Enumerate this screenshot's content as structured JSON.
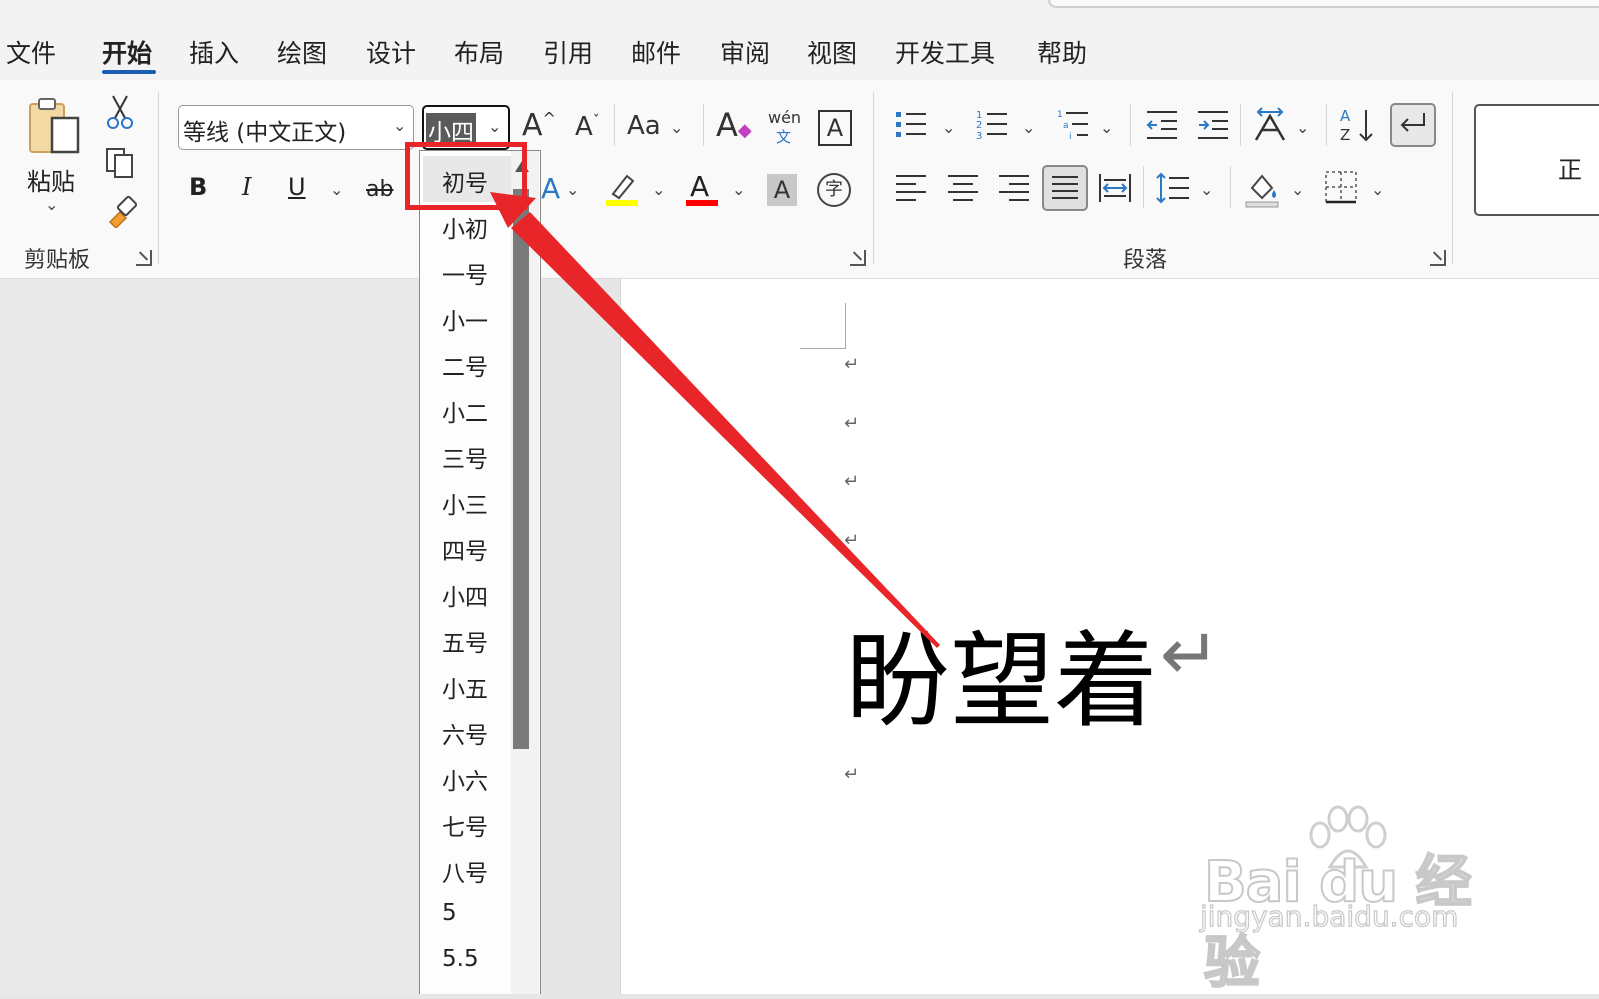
{
  "menu": {
    "tabs": [
      "文件",
      "开始",
      "插入",
      "绘图",
      "设计",
      "布局",
      "引用",
      "邮件",
      "审阅",
      "视图",
      "开发工具",
      "帮助"
    ],
    "active_tab": "开始"
  },
  "clipboard": {
    "paste_label": "粘贴",
    "group_label": "剪贴板"
  },
  "font": {
    "font_name": "等线 (中文正文)",
    "font_size": "小四",
    "grow_label": "A",
    "shrink_label": "A",
    "case_label": "Aa",
    "phonetic_top": "wén",
    "phonetic_bottom": "文",
    "border_char": "A",
    "bold": "B",
    "italic": "I",
    "underline": "U",
    "strike": "ab",
    "font_color_char": "A",
    "shade_char": "A",
    "enclose_char": "字",
    "highlight_color": "#ffff00",
    "font_color": "#ff0000"
  },
  "paragraph": {
    "group_label": "段落"
  },
  "styles": {
    "partial_label": "正"
  },
  "font_size_dropdown": {
    "items": [
      "初号",
      "小初",
      "一号",
      "小一",
      "二号",
      "小二",
      "三号",
      "小三",
      "四号",
      "小四",
      "五号",
      "小五",
      "六号",
      "小六",
      "七号",
      "八号",
      "5",
      "5.5"
    ],
    "highlighted": "初号"
  },
  "document": {
    "text": "盼望着",
    "paragraph_mark": "↵"
  },
  "annotation": {
    "color": "#e8262a"
  },
  "watermark": {
    "brand": "Bai du 经验",
    "url": "jingyan.baidu.com"
  }
}
